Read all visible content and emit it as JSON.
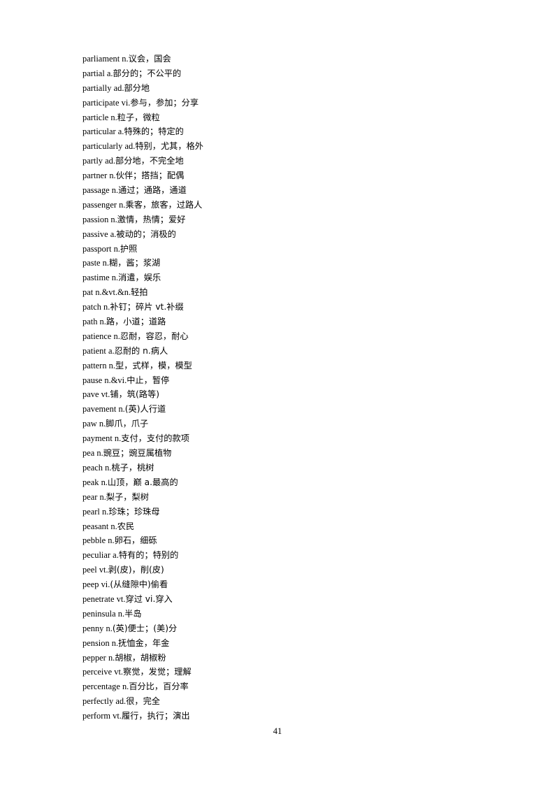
{
  "document": {
    "page_number": "41",
    "entries": [
      {
        "term": "parliament n.",
        "gloss": "议会，国会"
      },
      {
        "term": "partial a.",
        "gloss": "部分的；不公平的"
      },
      {
        "term": "partially ad.",
        "gloss": "部分地"
      },
      {
        "term": "participate  vi.",
        "gloss": "参与，参加；分享"
      },
      {
        "term": "particle n.",
        "gloss": "粒子，微粒"
      },
      {
        "term": "particular a.",
        "gloss": "特殊的；特定的"
      },
      {
        "term": "particularly ad.",
        "gloss": "特别，尤其，格外"
      },
      {
        "term": "partly ad.",
        "gloss": "部分地，不完全地"
      },
      {
        "term": "partner n.",
        "gloss": "伙伴；搭挡；配偶"
      },
      {
        "term": "passage n.",
        "gloss": "通过；通路，通道"
      },
      {
        "term": "passenger n.",
        "gloss": "乘客，旅客，过路人"
      },
      {
        "term": "passion n.",
        "gloss": "激情，热情；爱好"
      },
      {
        "term": "passive a.",
        "gloss": "被动的；消极的"
      },
      {
        "term": "passport n.",
        "gloss": "护照"
      },
      {
        "term": "paste n.",
        "gloss": "糊，酱；浆湖"
      },
      {
        "term": "pastime n.",
        "gloss": "消遣，娱乐"
      },
      {
        "term": "pat n.&vt.&n.",
        "gloss": "轻拍"
      },
      {
        "term": "patch n.",
        "gloss": "补钉；碎片  vt.补缀"
      },
      {
        "term": "path n.",
        "gloss": "路，小道；道路"
      },
      {
        "term": "patience n.",
        "gloss": "忍耐，容忍，耐心"
      },
      {
        "term": "patient a.",
        "gloss": "忍耐的  n.病人"
      },
      {
        "term": "pattern n.",
        "gloss": "型，式样，模，模型"
      },
      {
        "term": "pause n.&vi.",
        "gloss": "中止，暂停"
      },
      {
        "term": "pave vt.",
        "gloss": "铺，筑(路等)"
      },
      {
        "term": "pavement n.",
        "gloss": "(英)人行道"
      },
      {
        "term": "paw n.",
        "gloss": "脚爪，爪子"
      },
      {
        "term": "payment n.",
        "gloss": "支付，支付的款项"
      },
      {
        "term": "pea n.",
        "gloss": "豌豆；豌豆属植物"
      },
      {
        "term": "peach n.",
        "gloss": "桃子，桃树"
      },
      {
        "term": "peak n.",
        "gloss": "山顶，巅  a.最高的"
      },
      {
        "term": "pear n.",
        "gloss": "梨子，梨树"
      },
      {
        "term": "pearl n.",
        "gloss": "珍珠；珍珠母"
      },
      {
        "term": "peasant n.",
        "gloss": "农民"
      },
      {
        "term": "pebble n.",
        "gloss": "卵石，细砾"
      },
      {
        "term": "peculiar a.",
        "gloss": "特有的；特别的"
      },
      {
        "term": "peel vt.",
        "gloss": "剥(皮)，削(皮)"
      },
      {
        "term": "peep vi.",
        "gloss": "(从缝隙中)偷看"
      },
      {
        "term": "penetrate vt.",
        "gloss": "穿过  vi.穿入"
      },
      {
        "term": "peninsula n.",
        "gloss": "半岛"
      },
      {
        "term": "penny n.",
        "gloss": "(英)便士；(美)分"
      },
      {
        "term": "pension n.",
        "gloss": "抚恤金，年金"
      },
      {
        "term": "pepper n.",
        "gloss": "胡椒，胡椒粉"
      },
      {
        "term": "perceive vt.",
        "gloss": "察觉，发觉；理解"
      },
      {
        "term": "percentage n.",
        "gloss": "百分比，百分率"
      },
      {
        "term": "perfectly ad.",
        "gloss": "很，完全"
      },
      {
        "term": "perform vt.",
        "gloss": "履行，执行；演出"
      }
    ]
  }
}
